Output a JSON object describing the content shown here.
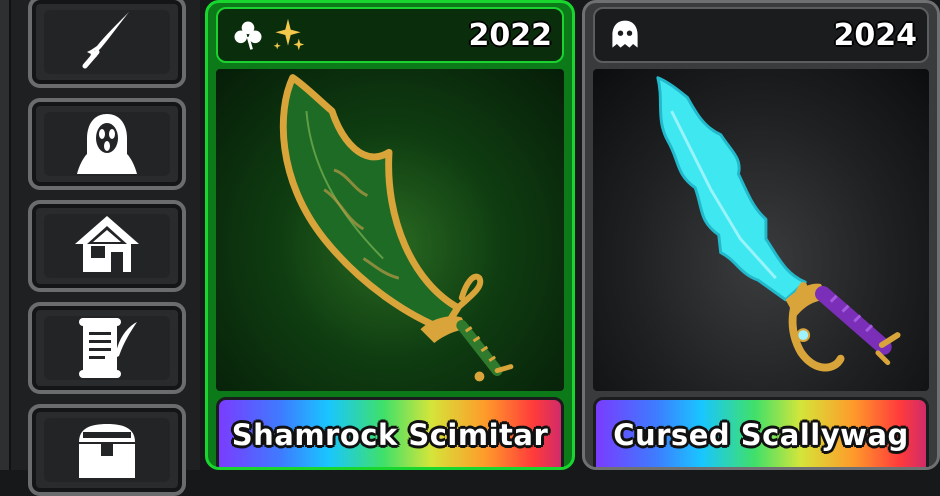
{
  "sidebar": {
    "items": [
      {
        "icon": "sword-icon"
      },
      {
        "icon": "ghost-mask-icon"
      },
      {
        "icon": "house-icon"
      },
      {
        "icon": "scroll-quill-icon"
      },
      {
        "icon": "treasure-chest-icon"
      }
    ]
  },
  "cards": [
    {
      "year": "2022",
      "name": "Shamrock Scimitar",
      "header_icons": [
        "clover-icon",
        "sparkle-icon"
      ],
      "frame_color": "#19d62f",
      "blade_color": "#1f7a2a"
    },
    {
      "year": "2024",
      "name": "Cursed Scallywag",
      "header_icons": [
        "ghost-icon"
      ],
      "frame_color": "#6f7072",
      "blade_color": "#3fe8f0"
    }
  ],
  "colors": {
    "gold": "#d9a53a",
    "purple_grip": "#7b2fb8"
  }
}
